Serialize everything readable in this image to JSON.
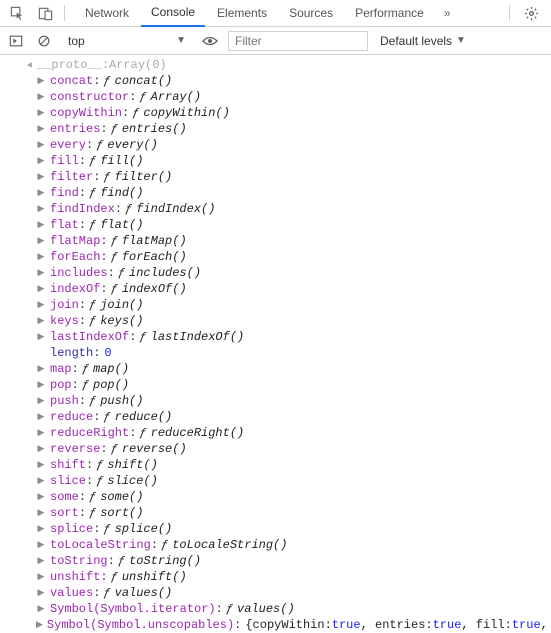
{
  "toolbar": {
    "tabs": [
      "Network",
      "Console",
      "Elements",
      "Sources",
      "Performance"
    ],
    "activeTab": 1,
    "more": "»"
  },
  "subbar": {
    "context": "top",
    "filterPlaceholder": "Filter",
    "levels": "Default levels"
  },
  "header": {
    "key": "__proto__",
    "val": "Array(0)"
  },
  "methods": [
    {
      "name": "concat",
      "fn": "concat()"
    },
    {
      "name": "constructor",
      "fn": "Array()"
    },
    {
      "name": "copyWithin",
      "fn": "copyWithin()"
    },
    {
      "name": "entries",
      "fn": "entries()"
    },
    {
      "name": "every",
      "fn": "every()"
    },
    {
      "name": "fill",
      "fn": "fill()"
    },
    {
      "name": "filter",
      "fn": "filter()"
    },
    {
      "name": "find",
      "fn": "find()"
    },
    {
      "name": "findIndex",
      "fn": "findIndex()"
    },
    {
      "name": "flat",
      "fn": "flat()"
    },
    {
      "name": "flatMap",
      "fn": "flatMap()"
    },
    {
      "name": "forEach",
      "fn": "forEach()"
    },
    {
      "name": "includes",
      "fn": "includes()"
    },
    {
      "name": "indexOf",
      "fn": "indexOf()"
    },
    {
      "name": "join",
      "fn": "join()"
    },
    {
      "name": "keys",
      "fn": "keys()"
    }
  ],
  "methods2": [
    {
      "name": "lastIndexOf",
      "fn": "lastIndexOf()"
    }
  ],
  "lengthRow": {
    "name": "length",
    "val": "0"
  },
  "methods3": [
    {
      "name": "map",
      "fn": "map()"
    },
    {
      "name": "pop",
      "fn": "pop()"
    },
    {
      "name": "push",
      "fn": "push()"
    },
    {
      "name": "reduce",
      "fn": "reduce()"
    },
    {
      "name": "reduceRight",
      "fn": "reduceRight()"
    },
    {
      "name": "reverse",
      "fn": "reverse()"
    },
    {
      "name": "shift",
      "fn": "shift()"
    },
    {
      "name": "slice",
      "fn": "slice()"
    },
    {
      "name": "some",
      "fn": "some()"
    },
    {
      "name": "sort",
      "fn": "sort()"
    },
    {
      "name": "splice",
      "fn": "splice()"
    },
    {
      "name": "toLocaleString",
      "fn": "toLocaleString()"
    },
    {
      "name": "toString",
      "fn": "toString()"
    },
    {
      "name": "unshift",
      "fn": "unshift()"
    },
    {
      "name": "values",
      "fn": "values()"
    }
  ],
  "symbolIter": {
    "name": "Symbol(Symbol.iterator)",
    "fn": "values()"
  },
  "symbolUnscope": {
    "name": "Symbol(Symbol.unscopables)",
    "parts": [
      "{copyWithin: ",
      "true",
      ", entries: ",
      "true",
      ", fill: ",
      "true",
      ", f"
    ]
  }
}
